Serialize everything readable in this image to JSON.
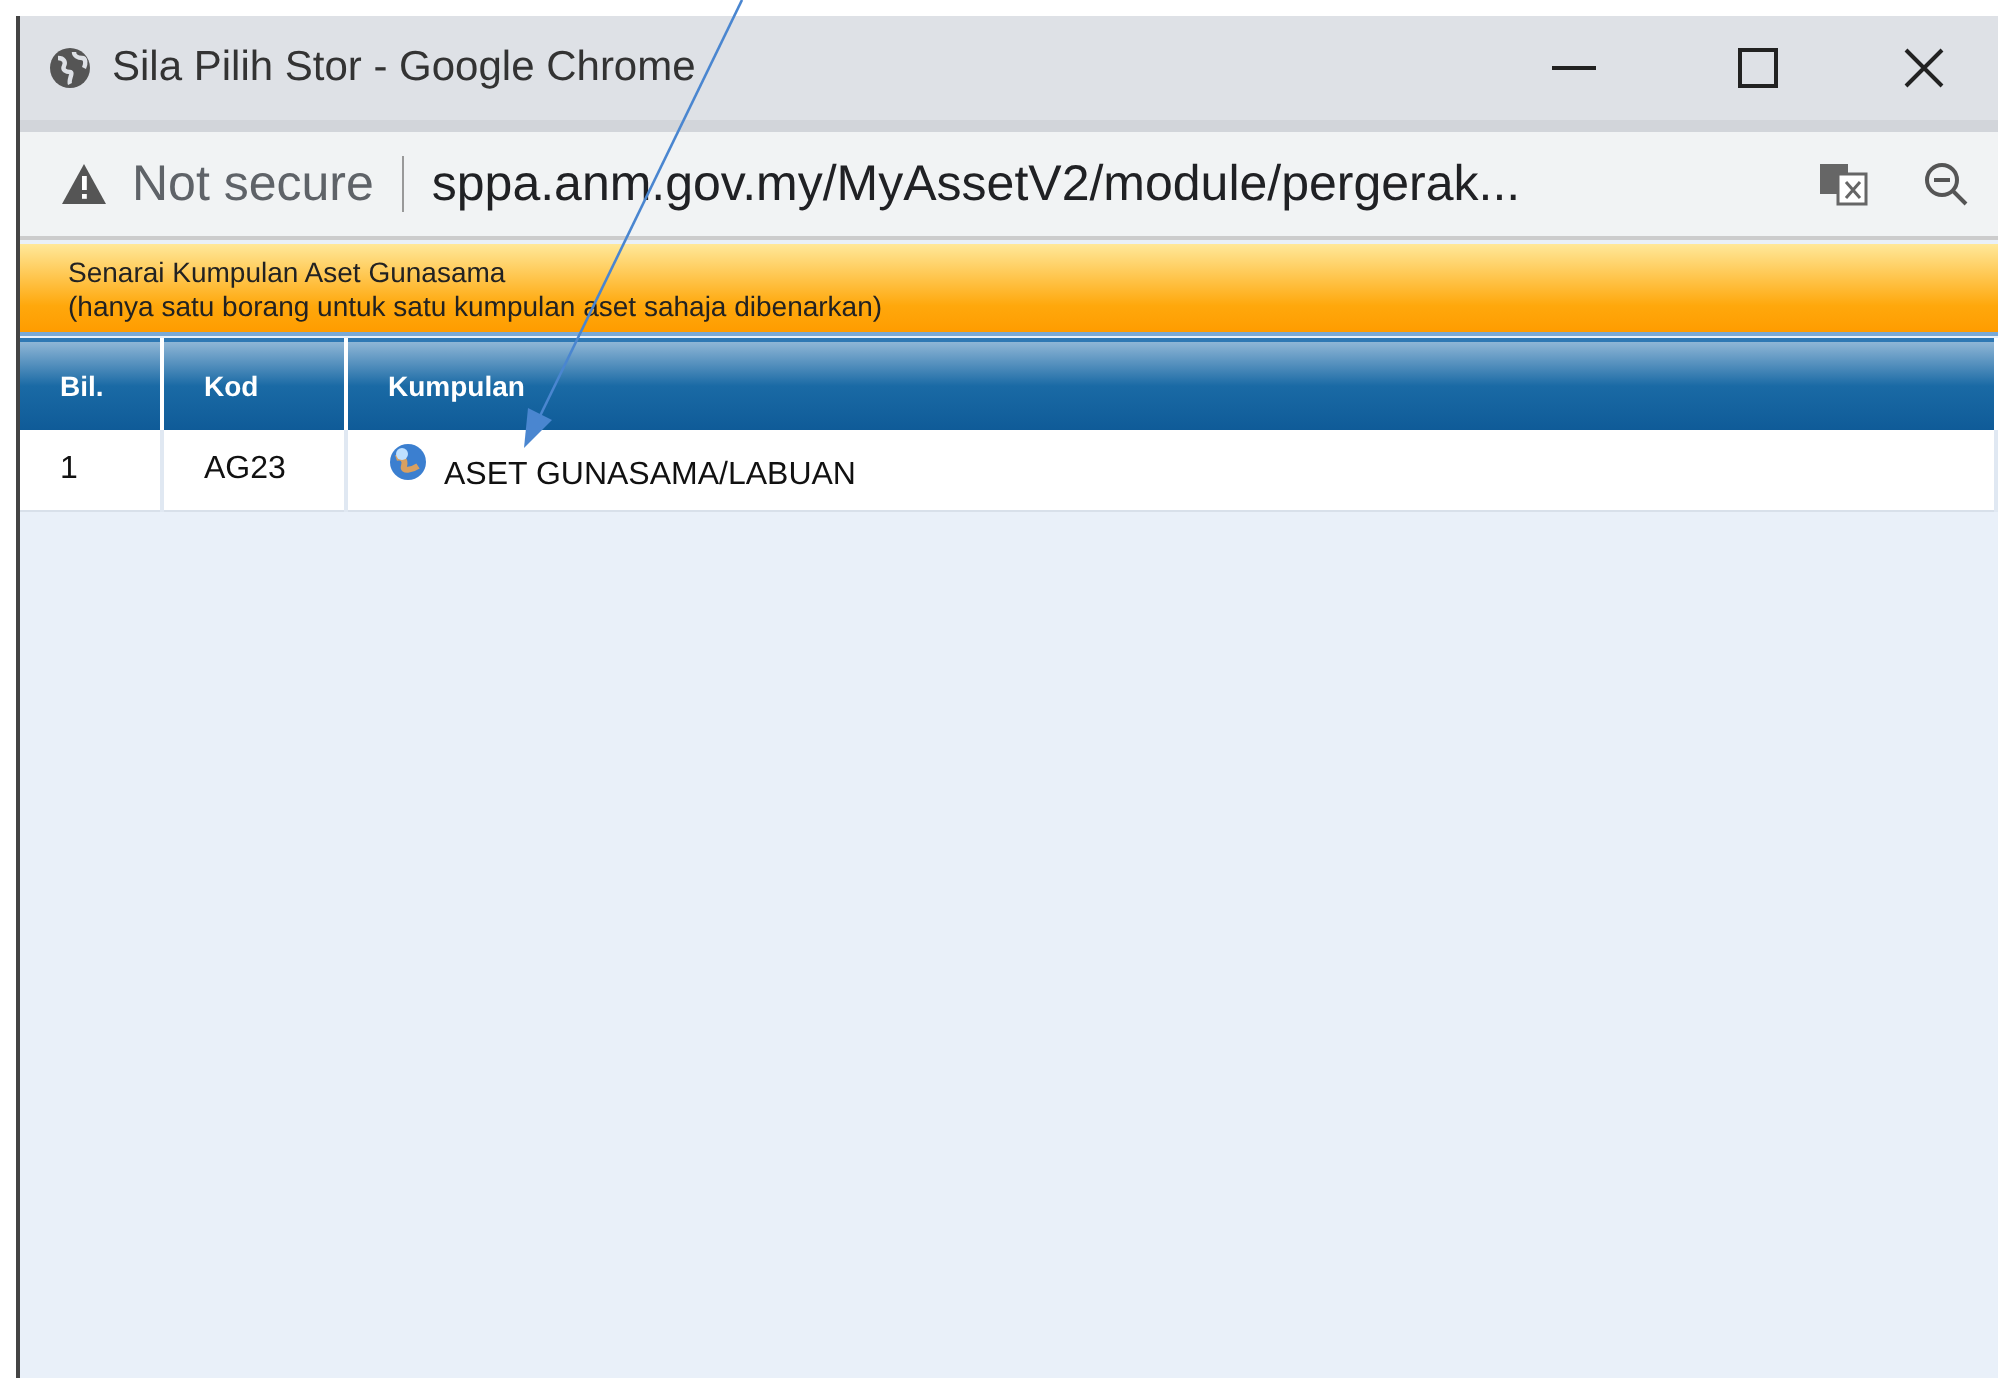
{
  "window": {
    "title": "Sila Pilih Stor - Google Chrome"
  },
  "address_bar": {
    "security": "Not secure",
    "url": "sppa.anm.gov.my/MyAssetV2/module/pergerak..."
  },
  "banner": {
    "title": "Senarai Kumpulan Aset Gunasama",
    "note": "(hanya satu borang untuk satu kumpulan aset sahaja dibenarkan)"
  },
  "table": {
    "columns": [
      "Bil.",
      "Kod",
      "Kumpulan"
    ],
    "rows": [
      {
        "cells": [
          "1",
          "AG23",
          "ASET GUNASAMA/LABUAN"
        ]
      }
    ]
  }
}
